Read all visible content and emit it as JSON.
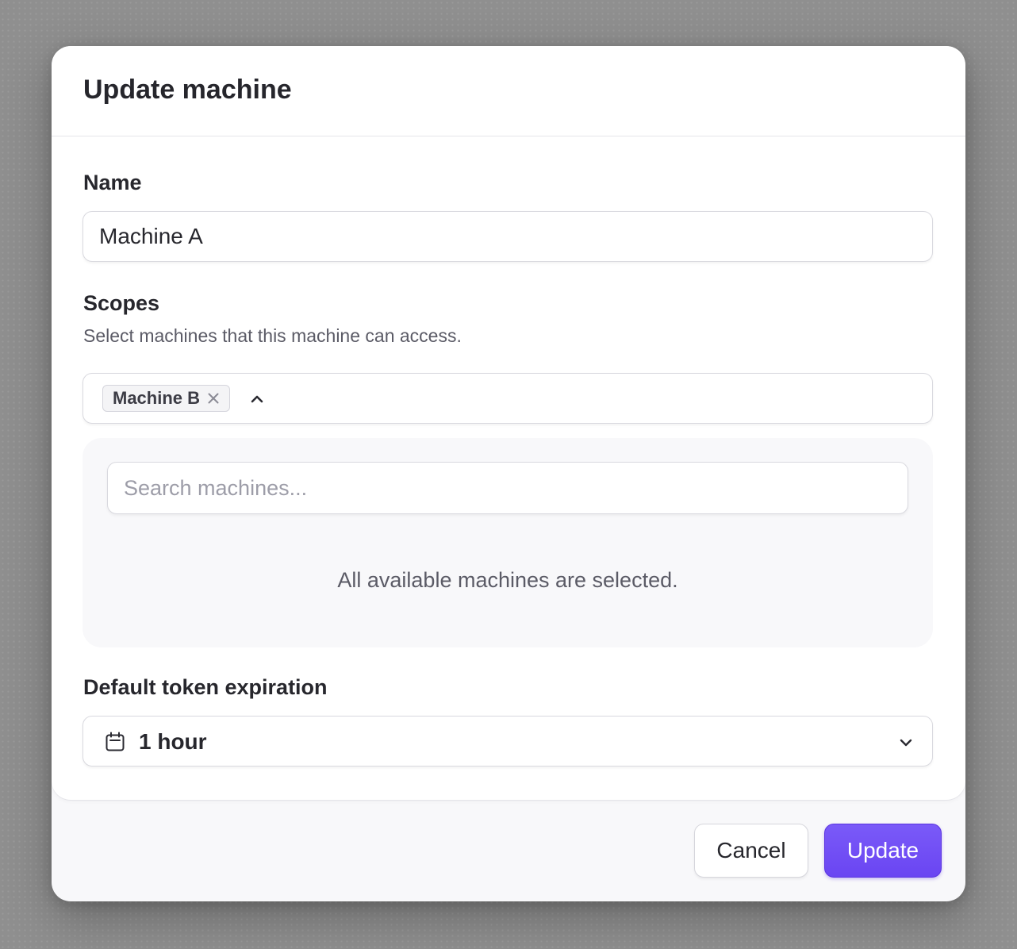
{
  "dialog": {
    "title": "Update machine"
  },
  "name_field": {
    "label": "Name",
    "value": "Machine A"
  },
  "scopes_field": {
    "label": "Scopes",
    "description": "Select machines that this machine can access.",
    "selected_chips": [
      "Machine B"
    ],
    "search_placeholder": "Search machines...",
    "empty_message": "All available machines are selected."
  },
  "expiration_field": {
    "label": "Default token expiration",
    "selected_value": "1 hour",
    "icon": "calendar-icon"
  },
  "footer": {
    "cancel_label": "Cancel",
    "update_label": "Update"
  },
  "colors": {
    "accent": "#6c47f5",
    "backdrop": "#8f8f8f"
  }
}
